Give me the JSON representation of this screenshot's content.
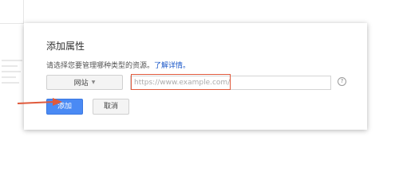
{
  "dialog": {
    "title": "添加属性",
    "description": "请选择您要管理哪种类型的资源。",
    "learn_more": "了解详情。",
    "property_type": {
      "selected": "网站",
      "icon": "chevron-down-icon"
    },
    "url_input": {
      "value": "",
      "placeholder": "https://www.example.com/"
    },
    "help_icon": "help-icon",
    "add_label": "添加",
    "cancel_label": "取消"
  },
  "colors": {
    "primary": "#4a8af4",
    "highlight": "#e05a3c",
    "link": "#1a57c8"
  }
}
